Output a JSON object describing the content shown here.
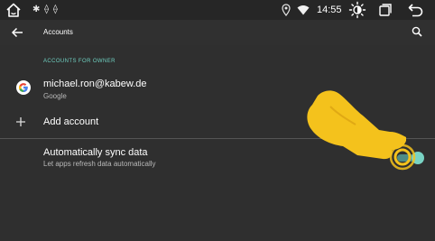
{
  "status_bar": {
    "notification_icons": "✱ ⟠ ⟠",
    "time": "14:55"
  },
  "app_bar": {
    "title": "Accounts"
  },
  "section": {
    "header": "ACCOUNTS FOR OWNER"
  },
  "account": {
    "email": "michael.ron@kabew.de",
    "type": "Google"
  },
  "add_account": {
    "label": "Add account"
  },
  "sync": {
    "title": "Automatically sync data",
    "subtitle": "Let apps refresh data automatically",
    "enabled": true
  },
  "colors": {
    "accent": "#6fcfc0",
    "background": "#2f2f2f",
    "status_bar": "#262626",
    "hand": "#f4c21c"
  }
}
